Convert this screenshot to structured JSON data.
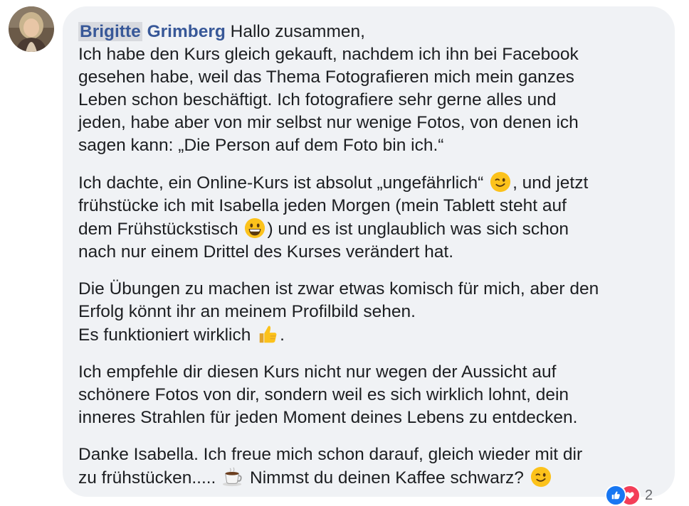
{
  "comment": {
    "author_first": "Brigitte",
    "author_last": "Grimberg",
    "p1": {
      "l1": "Hallo zusammen,",
      "l2": "Ich habe den Kurs gleich gekauft, nachdem ich ihn bei Facebook",
      "l3": "gesehen habe, weil das Thema Fotografieren mich mein ganzes",
      "l4": "Leben schon beschäftigt. Ich fotografiere sehr gerne alles und",
      "l5": "jeden, habe aber von mir selbst nur wenige Fotos, von denen ich",
      "l6": "sagen kann: „Die Person auf dem Foto bin ich.“"
    },
    "p2": {
      "l1a": "Ich dachte, ein Online-Kurs ist absolut „ungefährlich“",
      "l1b": ", und jetzt",
      "l2": "frühstücke ich mit Isabella jeden Morgen (mein Tablett steht auf",
      "l3a": "dem Frühstückstisch",
      "l3b": ") und es ist unglaublich was sich schon",
      "l4": "nach nur einem Drittel des Kurses verändert hat."
    },
    "p3": {
      "l1": "Die Übungen zu machen ist zwar etwas komisch für mich, aber den",
      "l2": "Erfolg könnt ihr an meinem Profilbild sehen.",
      "l3a": "Es funktioniert wirklich",
      "l3b": "."
    },
    "p4": {
      "l1": "Ich empfehle dir diesen Kurs nicht nur wegen der Aussicht auf",
      "l2": "schönere Fotos von dir, sondern weil es sich wirklich lohnt, dein",
      "l3": "inneres Strahlen für jeden Moment deines Lebens zu entdecken."
    },
    "p5": {
      "l1": "Danke Isabella. Ich freue mich schon darauf, gleich wieder mit dir",
      "l2a": "zu frühstücken.....",
      "l2b": "Nimmst du deinen Kaffee schwarz?"
    },
    "emojis": [
      "wink-emoji",
      "grin-emoji",
      "thumbs-up-emoji",
      "coffee-emoji",
      "wink-emoji"
    ]
  },
  "reactions": {
    "types": [
      "like-icon",
      "love-icon"
    ],
    "count": "2"
  },
  "colors": {
    "bubble_bg": "#f0f2f5",
    "author": "#385898",
    "text": "#1c1e21",
    "like": "#1877f2",
    "love": "#f33e58"
  }
}
